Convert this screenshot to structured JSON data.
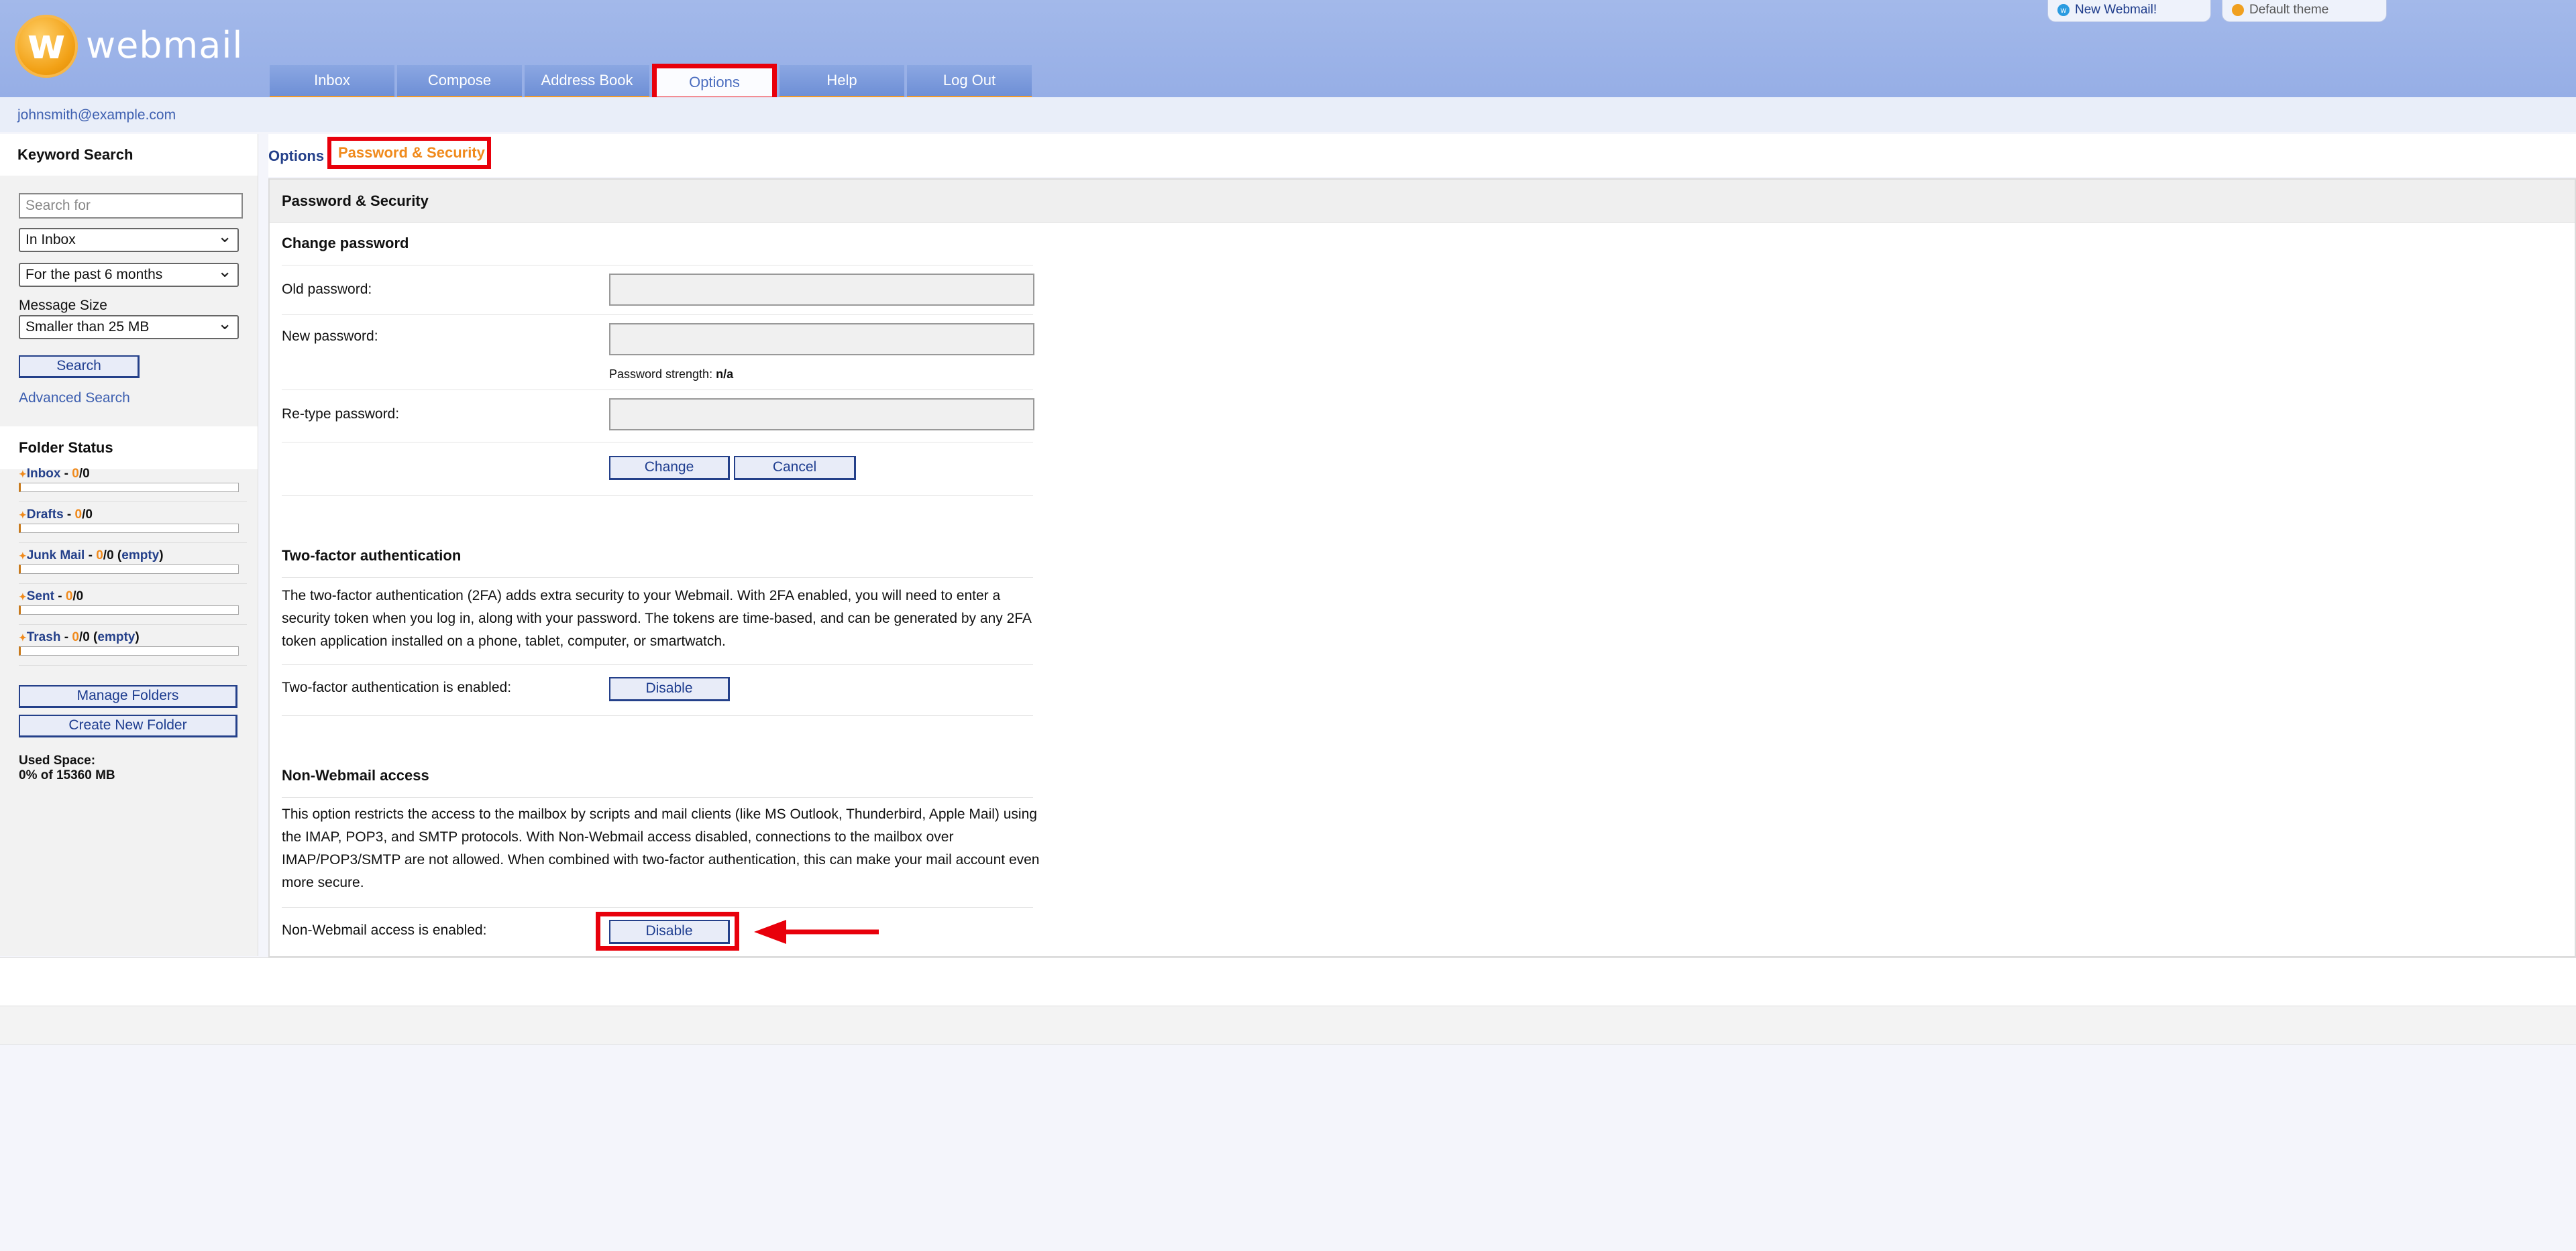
{
  "brand": {
    "logo_letter": "w",
    "name": "webmail"
  },
  "top_links": {
    "new_webmail": "New Webmail!",
    "theme": "Default theme"
  },
  "nav": {
    "tabs": [
      "Inbox",
      "Compose",
      "Address Book",
      "Options",
      "Help",
      "Log Out"
    ],
    "active": "Options"
  },
  "user": {
    "email": "johnsmith@example.com"
  },
  "search": {
    "title": "Keyword Search",
    "placeholder": "Search for",
    "folder_select": "In Inbox",
    "period_select": "For the past 6 months",
    "size_label": "Message Size",
    "size_select": "Smaller than 25 MB",
    "button": "Search",
    "advanced_link": "Advanced Search"
  },
  "folder_status": {
    "title": "Folder Status",
    "folders": [
      {
        "name": "Inbox",
        "unread": "0",
        "total": "0",
        "empty": ""
      },
      {
        "name": "Drafts",
        "unread": "0",
        "total": "0",
        "empty": ""
      },
      {
        "name": "Junk Mail",
        "unread": "0",
        "total": "0",
        "empty": "empty"
      },
      {
        "name": "Sent",
        "unread": "0",
        "total": "0",
        "empty": ""
      },
      {
        "name": "Trash",
        "unread": "0",
        "total": "0",
        "empty": "empty"
      }
    ],
    "manage_button": "Manage Folders",
    "create_button": "Create New Folder",
    "used_label": "Used Space:",
    "used_value": "0% of 15360 MB"
  },
  "breadcrumb": {
    "parent": "Options",
    "current": "Password & Security"
  },
  "panel": {
    "title": "Password & Security",
    "change_password": {
      "title": "Change password",
      "old_label": "Old password:",
      "new_label": "New password:",
      "strength_label": "Password strength:",
      "strength_value": "n/a",
      "retype_label": "Re-type password:",
      "change_button": "Change",
      "cancel_button": "Cancel"
    },
    "two_factor": {
      "title": "Two-factor authentication",
      "description": "The two-factor authentication (2FA) adds extra security to your Webmail. With 2FA enabled, you will need to enter a security token when you log in, along with your password. The tokens are time-based, and can be generated by any 2FA token application installed on a phone, tablet, computer, or smartwatch.",
      "status_label": "Two-factor authentication is enabled:",
      "button": "Disable"
    },
    "non_webmail": {
      "title": "Non-Webmail access",
      "description": "This option restricts the access to the mailbox by scripts and mail clients (like MS Outlook, Thunderbird, Apple Mail) using the IMAP, POP3, and SMTP protocols. With Non-Webmail access disabled, connections to the mailbox over IMAP/POP3/SMTP are not allowed. When combined with two-factor authentication, this can make your mail account even more secure.",
      "status_label": "Non-Webmail access is enabled:",
      "button": "Disable"
    }
  },
  "colors": {
    "highlight": "#e8000b",
    "accent_orange": "#f08a1c",
    "link_blue": "#24408a",
    "header_blue": "#96aee6"
  }
}
